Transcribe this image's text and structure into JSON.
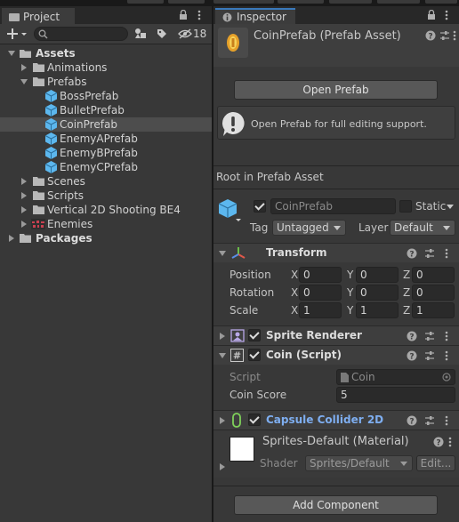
{
  "project": {
    "tab_label": "Project",
    "hidden_count": "18",
    "search_placeholder": "",
    "tree": [
      {
        "label": "Assets",
        "bold": true
      },
      {
        "label": "Animations"
      },
      {
        "label": "Prefabs"
      },
      {
        "label": "BossPrefab"
      },
      {
        "label": "BulletPrefab"
      },
      {
        "label": "CoinPrefab",
        "selected": true
      },
      {
        "label": "EnemyAPrefab"
      },
      {
        "label": "EnemyBPrefab"
      },
      {
        "label": "EnemyCPrefab"
      },
      {
        "label": "Scenes"
      },
      {
        "label": "Scripts"
      },
      {
        "label": "Vertical 2D Shooting BE4"
      },
      {
        "label": "Enemies"
      },
      {
        "label": "Packages",
        "bold": true
      }
    ]
  },
  "inspector": {
    "tab_label": "Inspector",
    "asset_title": "CoinPrefab (Prefab Asset)",
    "open_prefab_button": "Open Prefab",
    "info_message": "Open Prefab for full editing support.",
    "root_label": "Root in Prefab Asset",
    "object_name": "CoinPrefab",
    "static_label": "Static",
    "tag_label": "Tag",
    "tag_value": "Untagged",
    "layer_label": "Layer",
    "layer_value": "Default",
    "transform": {
      "title": "Transform",
      "position_label": "Position",
      "rotation_label": "Rotation",
      "scale_label": "Scale",
      "x": "X",
      "y": "Y",
      "z": "Z",
      "position": [
        "0",
        "0",
        "0"
      ],
      "rotation": [
        "0",
        "0",
        "0"
      ],
      "scale": [
        "1",
        "1",
        "1"
      ]
    },
    "sprite_renderer_title": "Sprite Renderer",
    "coin_script": {
      "title": "Coin (Script)",
      "script_label": "Script",
      "script_value": "Coin",
      "coin_score_label": "Coin Score",
      "coin_score_value": "5"
    },
    "capsule_title": "Capsule Collider 2D",
    "material": {
      "title": "Sprites-Default (Material)",
      "shader_label": "Shader",
      "shader_value": "Sprites/Default",
      "edit_label": "Edit..."
    },
    "add_component_button": "Add Component"
  },
  "colors": {
    "accent_blue": "#3a79bb",
    "capsule_title": "#7eaef0",
    "panel_bg": "#383838",
    "folder": "#b8b8b8",
    "prefab": "#5cb7ee"
  }
}
